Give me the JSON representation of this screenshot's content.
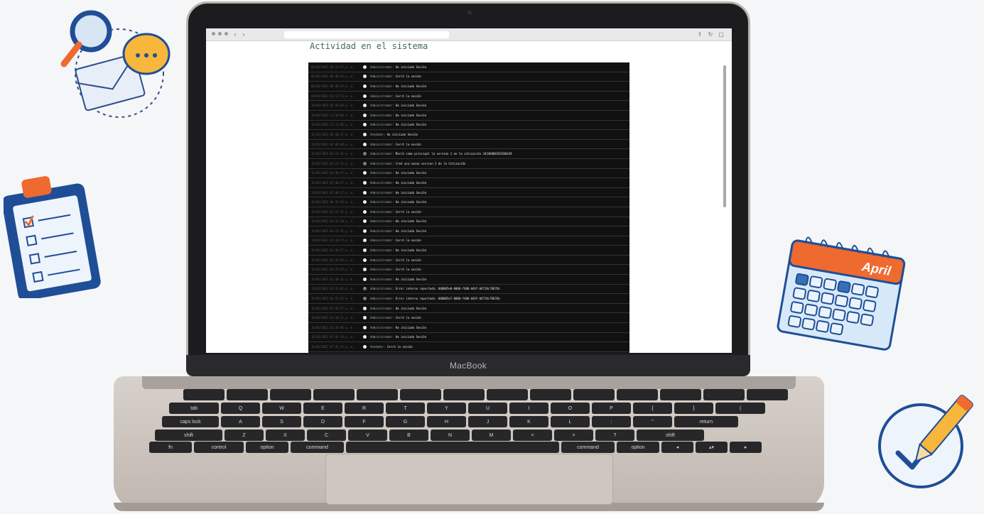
{
  "laptop": {
    "brand": "MacBook"
  },
  "browser": {
    "nav_back": "‹",
    "nav_forward": "›"
  },
  "page": {
    "title": "Actividad en el sistema"
  },
  "log_entries": [
    {
      "time": "04/05/2023 03:13:57 p. m.",
      "actor": "Administrador:",
      "message": "Ha iniciado Sesión",
      "level": "info"
    },
    {
      "time": "04/05/2023 03:40:33 p. m.",
      "actor": "Administrador:",
      "message": "Cerró la sesión",
      "level": "info"
    },
    {
      "time": "04/05/2023 04:49:33 p. m.",
      "actor": "Administrador:",
      "message": "Ha iniciado Sesión",
      "level": "info"
    },
    {
      "time": "04/05/2023 03:52:53 p. m.",
      "actor": "Administrador:",
      "message": "Cerró la sesión",
      "level": "info"
    },
    {
      "time": "10/05/2023 02:59:08 p. m.",
      "actor": "Administrador:",
      "message": "Ha iniciado Sesión",
      "level": "info"
    },
    {
      "time": "10/05/2023 11:59:00 a. m.",
      "actor": "Administrador:",
      "message": "Ha iniciado Sesión",
      "level": "info"
    },
    {
      "time": "10/05/2023 12:11:06 p. m.",
      "actor": "Administrador:",
      "message": "Ha iniciado Sesión",
      "level": "info"
    },
    {
      "time": "11/05/2023 03:40:17 p. m.",
      "actor": "Vendedor:",
      "message": "Ha iniciado Sesión",
      "level": "info"
    },
    {
      "time": "11/05/2023 02:09:40 p. m.",
      "actor": "Administrador:",
      "message": "Cerró la sesión",
      "level": "info"
    },
    {
      "time": "11/05/2023 01:21:35 p. m.",
      "actor": "Administrador:",
      "message": "Marcó como principal la version 2 en la cotización 34240808381500438",
      "level": "warn"
    },
    {
      "time": "11/05/2023 01:21:12 p. m.",
      "actor": "Administrador:",
      "message": "Creó una nueva version 2 de la Cotización",
      "level": "warn"
    },
    {
      "time": "11/05/2023 01:40:57 p. m.",
      "actor": "Administrador:",
      "message": "Ha iniciado Sesión",
      "level": "info"
    },
    {
      "time": "12/05/2023 07:40:57 p. m.",
      "actor": "Administrador:",
      "message": "Ha iniciado Sesión",
      "level": "info"
    },
    {
      "time": "12/05/2023 07:40:27 p. m.",
      "actor": "Administrador:",
      "message": "Ha iniciado Sesión",
      "level": "info"
    },
    {
      "time": "12/05/2023 06:33:39 p. m.",
      "actor": "Administrador:",
      "message": "Ha iniciado Sesión",
      "level": "info"
    },
    {
      "time": "14/05/2023 01:23:31 p. m.",
      "actor": "Administrador:",
      "message": "Cerró la sesión",
      "level": "info"
    },
    {
      "time": "14/05/2023 01:22:30 p. m.",
      "actor": "Administrador:",
      "message": "Ha iniciado Sesión",
      "level": "info"
    },
    {
      "time": "14/05/2023 01:22:41 p. m.",
      "actor": "Administrador:",
      "message": "Ha iniciado Sesión",
      "level": "info"
    },
    {
      "time": "14/05/2023 01:20:57 p. m.",
      "actor": "Administrador:",
      "message": "Cerró la sesión",
      "level": "info"
    },
    {
      "time": "15/05/2023 01:38:57 p. m.",
      "actor": "Administrador:",
      "message": "Ha iniciado Sesión",
      "level": "info"
    },
    {
      "time": "15/05/2023 01:39:03 p. m.",
      "actor": "Administrador:",
      "message": "Cerró la sesión",
      "level": "info"
    },
    {
      "time": "15/05/2023 01:29:55 p. m.",
      "actor": "Administrador:",
      "message": "Cerró la sesión",
      "level": "info"
    },
    {
      "time": "15/05/2023 01:40:11 p. m.",
      "actor": "Administrador:",
      "message": "Ha iniciado Sesión",
      "level": "info"
    },
    {
      "time": "15/05/2023 01:55:01 p. m.",
      "actor": "Administrador:",
      "message": "Error interno reportado: 000005e0-0000-f400-b03f-04718c78676b",
      "level": "warn"
    },
    {
      "time": "15/05/2023 01:55:22 p. m.",
      "actor": "Administrador:",
      "message": "Error interno reportado: 000005e7-0000-f400-b03f-04718c78676b",
      "level": "warn"
    },
    {
      "time": "15/05/2023 01:18:57 p. m.",
      "actor": "Administrador:",
      "message": "Ha iniciado Sesión",
      "level": "info"
    },
    {
      "time": "16/05/2023 01:16:21 p. m.",
      "actor": "Administrador:",
      "message": "Cerró la sesión",
      "level": "info"
    },
    {
      "time": "16/05/2023 01:20:06 p. m.",
      "actor": "Administrador:",
      "message": "Ha iniciado Sesión",
      "level": "info"
    },
    {
      "time": "16/05/2023 07:45:19 p. m.",
      "actor": "Administrador:",
      "message": "Ha iniciado Sesión",
      "level": "info"
    },
    {
      "time": "16/05/2023 07:45:51 p. m.",
      "actor": "Vendedor:",
      "message": "Cerró la sesión",
      "level": "info"
    }
  ],
  "keyboard": {
    "row2": [
      "tab",
      "Q",
      "W",
      "E",
      "R",
      "T",
      "Y",
      "U",
      "I",
      "O",
      "P",
      "{",
      "}",
      "|"
    ],
    "row3": [
      "caps lock",
      "A",
      "S",
      "D",
      "F",
      "G",
      "H",
      "J",
      "K",
      "L",
      ":",
      "\"",
      "return"
    ],
    "row4": [
      "shift",
      "Z",
      "X",
      "C",
      "V",
      "B",
      "N",
      "M",
      "<",
      ">",
      "?",
      "shift"
    ],
    "row5": [
      "fn",
      "control",
      "option",
      "command",
      "",
      "command",
      "option",
      "◂",
      "▴▾",
      "▸"
    ]
  },
  "decor": {
    "calendar_month": "April"
  },
  "colors": {
    "page_bg": "#f5f6f8",
    "title_green": "#3f6b4f",
    "log_bg": "#111111",
    "accent_orange": "#ef6a2e",
    "accent_blue": "#1f5aa6"
  }
}
